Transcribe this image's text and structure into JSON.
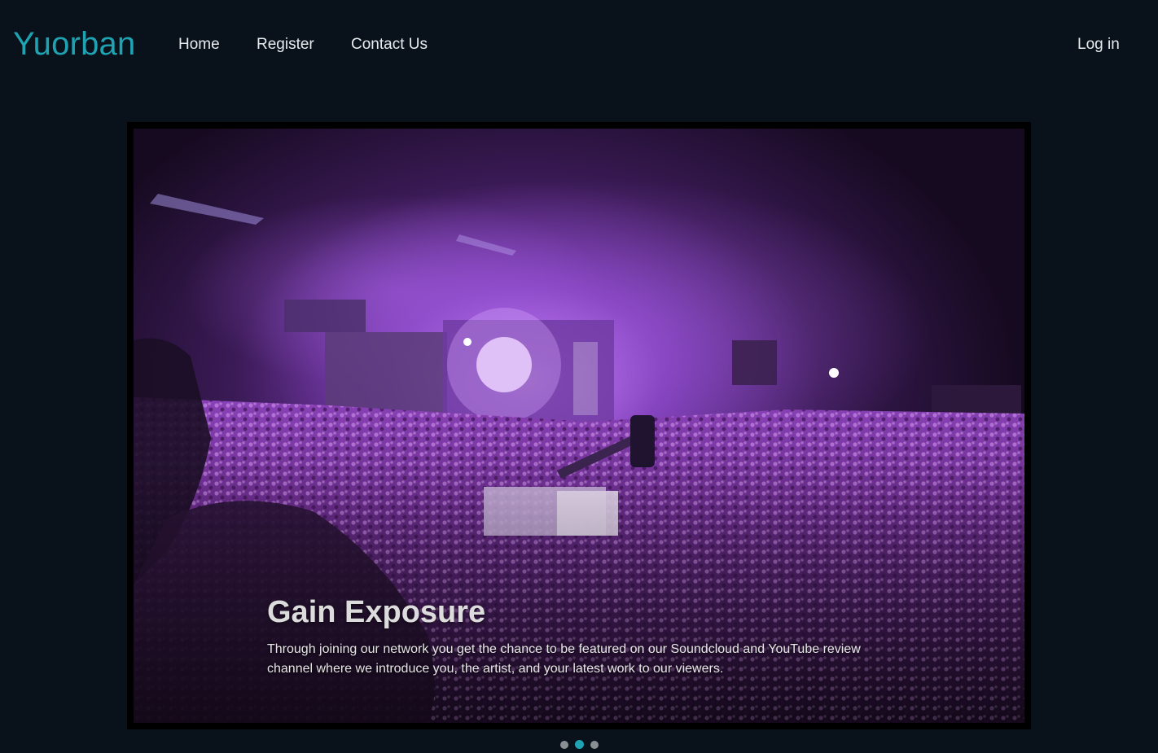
{
  "nav": {
    "brand": "Yuorban",
    "links": [
      "Home",
      "Register",
      "Contact Us"
    ],
    "login": "Log in"
  },
  "carousel": {
    "slide_count": 3,
    "active_index": 1,
    "caption_title": "Gain Exposure",
    "caption_text": "Through joining our network you get the chance to be featured on our Soundcloud and YouTube review channel where we introduce you, the artist, and your latest work to our viewers."
  },
  "colors": {
    "background": "#09111a",
    "brand": "#1fa3b2",
    "active_indicator": "#1fa3b2",
    "inactive_indicator": "#8a8f94"
  }
}
